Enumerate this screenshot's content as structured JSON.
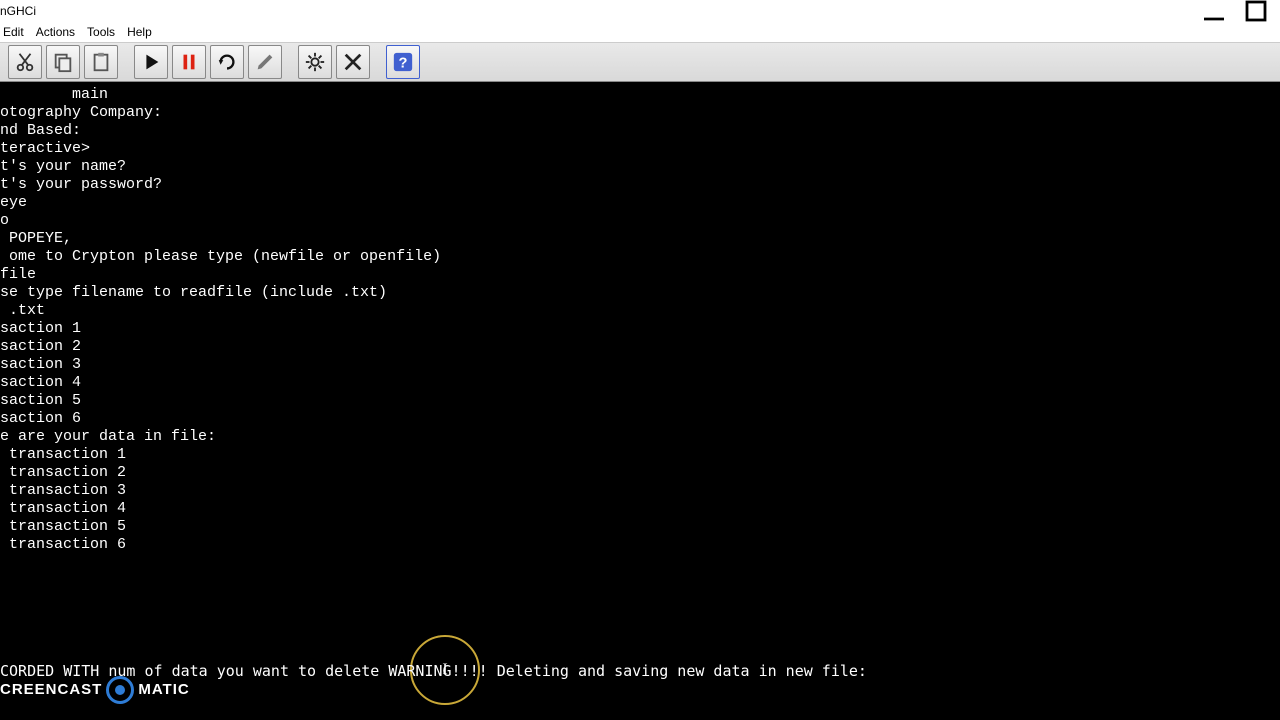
{
  "window": {
    "title": "nGHCi"
  },
  "menu": {
    "edit": "Edit",
    "actions": "Actions",
    "tools": "Tools",
    "help": "Help"
  },
  "terminal": {
    "lines": [
      "      main",
      "otography Company:",
      "nd Based:",
      "teractive>",
      "t's your name?",
      "",
      "t's your password?",
      "eye",
      "o",
      " POPEYE,",
      " ome to Crypton please type (newfile or openfile)",
      "file",
      "se type filename to readfile (include .txt)",
      " .txt",
      "saction 1",
      "saction 2",
      "saction 3",
      "saction 4",
      "saction 5",
      "saction 6",
      "",
      "",
      "e are your data in file:",
      " transaction 1",
      " transaction 2",
      " transaction 3",
      " transaction 4",
      " transaction 5",
      " transaction 6",
      ""
    ],
    "bottom_line": "CORDED WITH num of data you want to delete WARNING!!!! Deleting and saving new data in new file:"
  },
  "watermark": {
    "left": "CREENCAST",
    "right": "MATIC"
  }
}
